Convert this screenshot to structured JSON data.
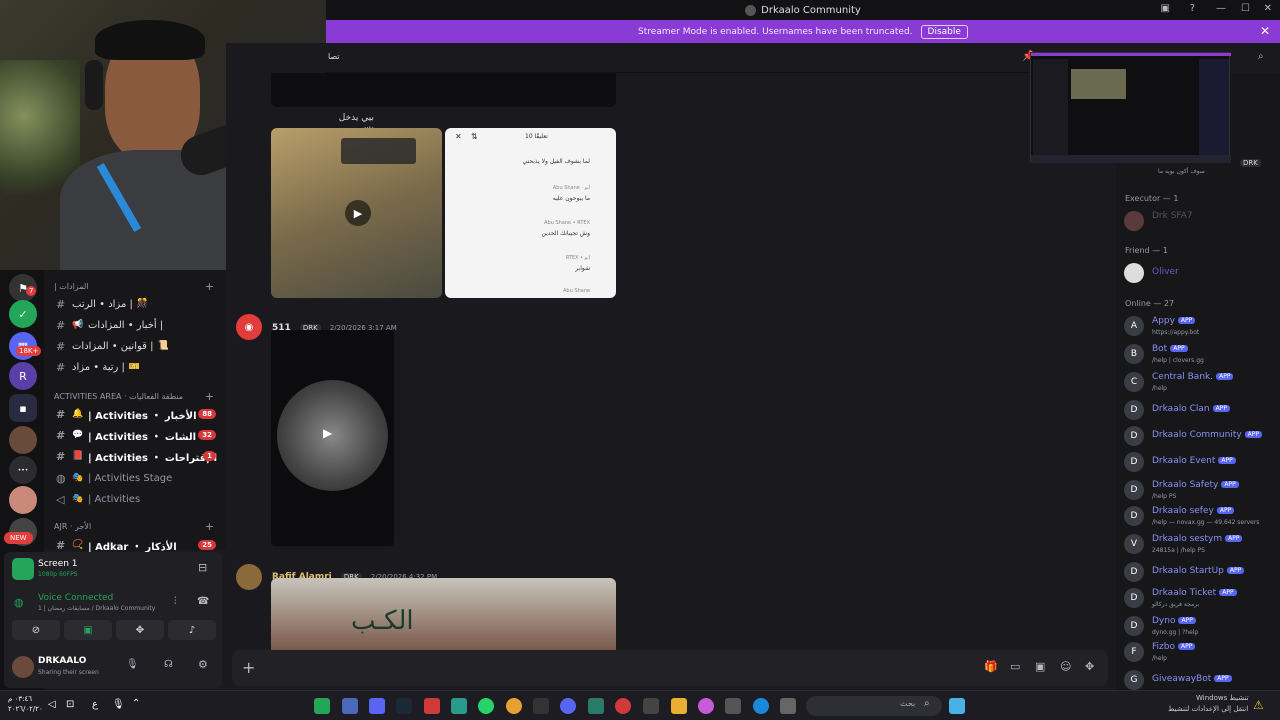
{
  "titlebar": {
    "title": "Drkaalo Community"
  },
  "banner": {
    "text": "Streamer Mode is enabled. Usernames have been truncated.",
    "disable_label": "Disable"
  },
  "header": {
    "channel_fragment": "تصا"
  },
  "server_rail": {
    "badges": [
      "7",
      "18K+"
    ],
    "new_label": "NEW"
  },
  "channel_list": {
    "category1": "| المزادات",
    "category2": "ACTIVITIES AREA · منطقة الفعاليات",
    "category3": "AJR · الأجر",
    "items": [
      {
        "label": "مزاد • الرتب |",
        "emoji": "🎊"
      },
      {
        "label": "أخبار • المزادات |",
        "emoji": "📢"
      },
      {
        "label": "قوانين • المزادات |",
        "emoji": "📜"
      },
      {
        "label": "رتبة • مزاد |",
        "emoji": "🎫"
      },
      {
        "label": "| Activities ・ الأخبار",
        "emoji": "🔔",
        "count": "88"
      },
      {
        "label": "| Activities ・ الشات",
        "emoji": "💬",
        "count": "32"
      },
      {
        "label": "| Activities ・ الإقتراحات",
        "emoji": "📕",
        "count": "1"
      },
      {
        "label": "| Activities Stage",
        "emoji": "🎭"
      },
      {
        "label": "| Activities",
        "emoji": "🎭"
      },
      {
        "label": "| Adkar ・ الأذكار",
        "emoji": "📿",
        "count": "25"
      }
    ]
  },
  "voice": {
    "screen_title": "Screen 1",
    "screen_sub": "1080p 60FPS",
    "status": "Voice Connected",
    "status_sub": "1 | مسابقات رمضان / Drkaalo Community",
    "user": "DRKAALO",
    "user_status": "Sharing their screen"
  },
  "chat": {
    "caption": "بيي يدخل بس",
    "phone_header": "10 تعليقًا",
    "comments": [
      "لما بشوف الفيل ولا يذبحني",
      "Abu Shane · ابو",
      "ما يبوحون عليه",
      "Abu Shane • RTEX",
      "وش تجيبانك الحدين",
      "RTEX • ابو",
      "شوابر",
      "Abu Shane"
    ],
    "messages": [
      {
        "author": "511",
        "tag": "DRK",
        "time": "2/20/2026 3:17 AM"
      },
      {
        "author": "Rafif Alamri",
        "tag": "DRK",
        "time": "2/20/2026 4:32 PM"
      }
    ],
    "video_caption": "الكـب"
  },
  "members": {
    "top_status": "سوف أكون بويه ما",
    "top_tag": "DRK",
    "executor_header": "Executor — 1",
    "executor_name": "Drk SFA7",
    "friend_header": "Friend — 1",
    "friend_name": "Oliver",
    "online_header": "Online — 27",
    "list": [
      {
        "name": "Appy",
        "status": "https://appy.bot",
        "avatar": "A"
      },
      {
        "name": "Bot",
        "status": "/help | clovers.gg",
        "avatar": "B"
      },
      {
        "name": "Central Bank.",
        "status": "/help",
        "avatar": "C"
      },
      {
        "name": "Drkaalo Clan",
        "status": "",
        "avatar": "D"
      },
      {
        "name": "Drkaalo Community",
        "status": "",
        "avatar": "D"
      },
      {
        "name": "Drkaalo Event",
        "status": "",
        "avatar": "D"
      },
      {
        "name": "Drkaalo Safety",
        "status": "/help PS",
        "avatar": "D"
      },
      {
        "name": "Drkaalo sefey",
        "status": "/help — novax.gg — 49,642 servers",
        "avatar": "D"
      },
      {
        "name": "Drkaalo sestym",
        "status": "24815a | /help PS",
        "avatar": "V"
      },
      {
        "name": "Drkaalo StartUp",
        "status": "",
        "avatar": "D"
      },
      {
        "name": "Drkaalo Ticket",
        "status": "برمجة فريق دركالو",
        "avatar": "D"
      },
      {
        "name": "Dyno",
        "status": "dyno.gg | ?help",
        "avatar": "D"
      },
      {
        "name": "Fizbo",
        "status": "/help",
        "avatar": "F"
      },
      {
        "name": "GiveawayBot",
        "status": "",
        "avatar": "G"
      }
    ],
    "app_label": "APP"
  },
  "taskbar": {
    "time": "٠٣:٤٦ م",
    "date": "٢٠٢٦/٠٢/٢٠",
    "lang": "ع",
    "search_placeholder": "بحث",
    "activation_line1": "تنشيط Windows",
    "activation_line2": "انتقل إلى الإعدادات لتنشيط"
  },
  "colors": {
    "banner": "#8a3bd6",
    "accent": "#5865f2",
    "voice_green": "#23a55a",
    "badge_red": "#e23d3d"
  }
}
